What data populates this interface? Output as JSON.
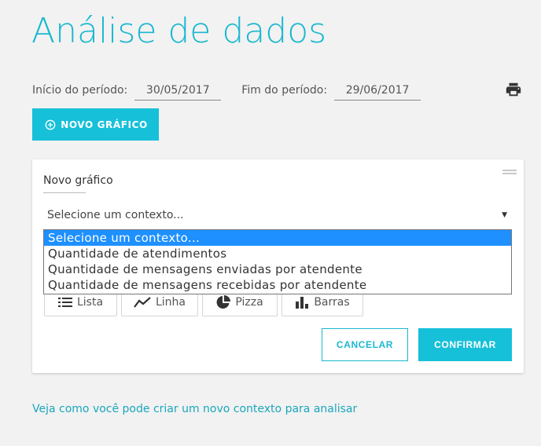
{
  "page": {
    "title": "Análise de dados"
  },
  "period": {
    "start_label": "Início do período:",
    "start_value": "30/05/2017",
    "end_label": "Fim do período:",
    "end_value": "29/06/2017"
  },
  "toolbar": {
    "new_chart_label": "NOVO GRÁFICO"
  },
  "card": {
    "title": "Novo gráfico",
    "select_value": "Selecione um contexto...",
    "options": [
      "Selecione um contexto...",
      "Quantidade de atendimentos",
      "Quantidade de mensagens enviadas por atendente",
      "Quantidade de mensagens recebidas por atendente"
    ],
    "chart_types": [
      "Lista",
      "Linha",
      "Pizza",
      "Barras"
    ],
    "cancel_label": "CANCELAR",
    "confirm_label": "CONFIRMAR"
  },
  "footer": {
    "help_link": "Veja como você pode criar um novo contexto para analisar"
  },
  "colors": {
    "accent": "#17c0d9",
    "selected_option": "#1e90ff"
  },
  "icons": [
    "print-icon",
    "plus-circle-icon",
    "drag-handle-icon",
    "list-icon",
    "line-chart-icon",
    "pie-chart-icon",
    "bar-chart-icon"
  ]
}
